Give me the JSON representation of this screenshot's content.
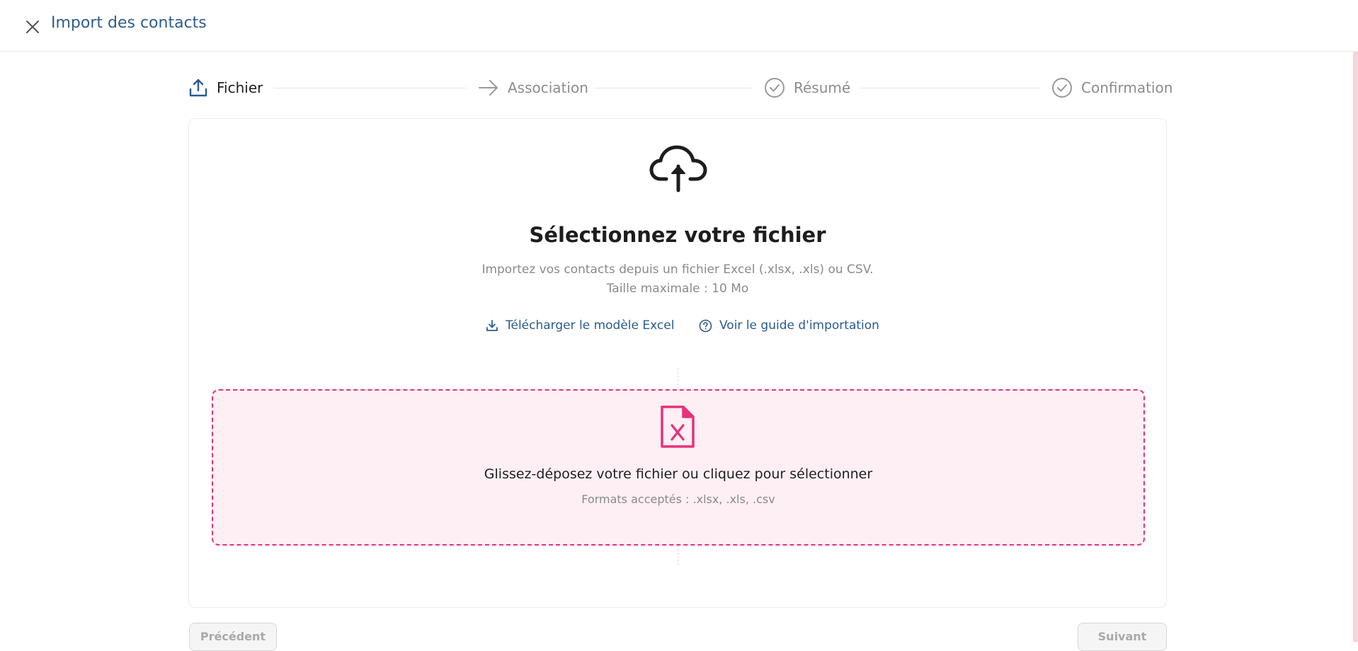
{
  "header": {
    "title": "Import des contacts",
    "close_icon": "close-icon"
  },
  "stepper": {
    "steps": [
      {
        "label": "Fichier",
        "icon": "upload-icon",
        "state": "active"
      },
      {
        "label": "Association",
        "icon": "arrow-right-icon",
        "state": "inactive"
      },
      {
        "label": "Résumé",
        "icon": "check-circle-icon",
        "state": "inactive"
      },
      {
        "label": "Confirmation",
        "icon": "check-circle-icon",
        "state": "inactive"
      }
    ]
  },
  "upload": {
    "icon": "cloud-upload-icon",
    "title": "Sélectionnez votre fichier",
    "description": "Importez vos contacts depuis un fichier Excel (.xlsx, .xls) ou CSV.",
    "max_size": "Taille maximale : 10 Mo",
    "download_template_label": "Télécharger le modèle Excel",
    "guide_label": "Voir le guide d'importation"
  },
  "dropzone": {
    "icon": "excel-file-icon",
    "title": "Glissez-déposez votre fichier ou cliquez pour sélectionner",
    "formats": "Formats acceptés : .xlsx, .xls, .csv"
  },
  "footer": {
    "previous_label": "Précédent",
    "next_label": "Suivant"
  },
  "colors": {
    "accent_blue": "#2a5b8f",
    "accent_pink": "#e8317a",
    "dropzone_bg": "#fdeff3"
  }
}
